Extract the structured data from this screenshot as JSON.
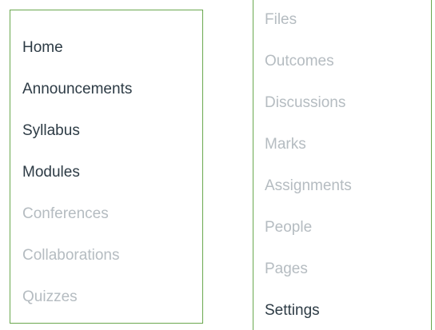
{
  "left_menu": {
    "items": [
      {
        "label": "Home",
        "state": "active"
      },
      {
        "label": "Announcements",
        "state": "active"
      },
      {
        "label": "Syllabus",
        "state": "active"
      },
      {
        "label": "Modules",
        "state": "active"
      },
      {
        "label": "Conferences",
        "state": "disabled"
      },
      {
        "label": "Collaborations",
        "state": "disabled"
      },
      {
        "label": "Quizzes",
        "state": "disabled"
      }
    ]
  },
  "right_menu": {
    "items": [
      {
        "label": "Files",
        "state": "disabled"
      },
      {
        "label": "Outcomes",
        "state": "disabled"
      },
      {
        "label": "Discussions",
        "state": "disabled"
      },
      {
        "label": "Marks",
        "state": "disabled"
      },
      {
        "label": "Assignments",
        "state": "disabled"
      },
      {
        "label": "People",
        "state": "disabled"
      },
      {
        "label": "Pages",
        "state": "disabled"
      },
      {
        "label": "Settings",
        "state": "active"
      }
    ]
  },
  "colors": {
    "border": "#6aa84f",
    "text_active": "#2d3b45",
    "text_disabled": "#b5bcc1"
  }
}
